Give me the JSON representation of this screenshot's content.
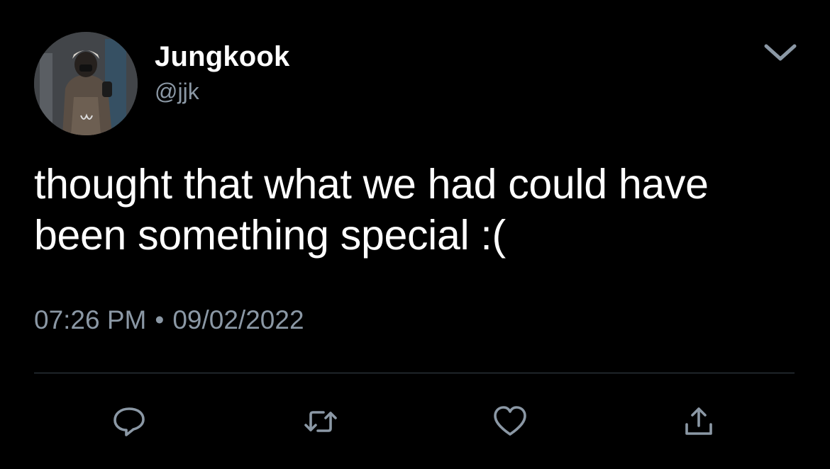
{
  "user": {
    "display_name": "Jungkook",
    "handle": "@jjk"
  },
  "tweet": {
    "text": "thought that what we had could have been something special :(",
    "time": "07:26 PM",
    "separator": "•",
    "date": "09/02/2022"
  },
  "icons": {
    "menu": "chevron-down-icon",
    "reply": "reply-icon",
    "retweet": "retweet-icon",
    "like": "heart-icon",
    "share": "share-icon"
  },
  "colors": {
    "background": "#000000",
    "text": "#ffffff",
    "secondary_text": "#8b98a5",
    "divider": "#38444d",
    "icon": "#8b98a5"
  }
}
